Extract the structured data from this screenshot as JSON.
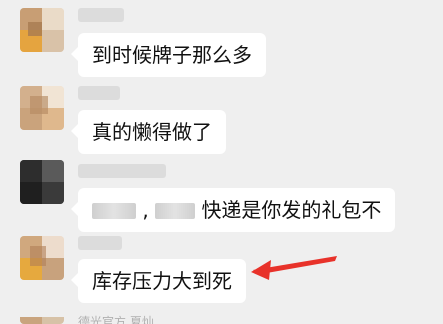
{
  "messages": [
    {
      "text": "到时候牌子那么多"
    },
    {
      "text": "真的懒得做了"
    },
    {
      "text_parts": [
        ",",
        "快递是你发的礼包不"
      ]
    },
    {
      "text": "库存压力大到死"
    }
  ],
  "footer": {
    "partial_name": "德光官方 夏灿"
  },
  "colors": {
    "background": "#efefef",
    "bubble": "#ffffff",
    "arrow": "#e8322a"
  }
}
